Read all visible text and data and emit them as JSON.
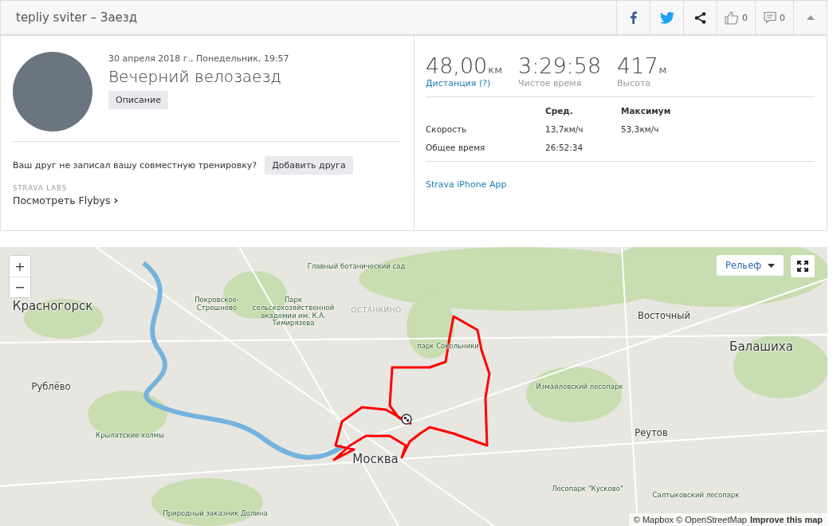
{
  "header": {
    "title": "tepliy sviter – Заезд",
    "kudos_count": "0",
    "comments_count": "0"
  },
  "activity": {
    "date": "30 апреля 2018 г., Понедельник, 19:57",
    "name": "Вечерний велозаезд",
    "description_button": "Описание",
    "friend_prompt": "Ваш друг не записал вашу совместную тренировку?",
    "add_friend_button": "Добавить друга",
    "labs_label": "STRAVA LABS",
    "flybys_link": "Посмотреть Flybys",
    "flybys_arrow": "›"
  },
  "stats": {
    "primary": [
      {
        "value": "48,00",
        "unit": "км",
        "label": "Дистанция (?)",
        "kind": "link"
      },
      {
        "value": "3:29:58",
        "label": "Чистое время",
        "kind": "plain"
      },
      {
        "value": "417",
        "unit": "м",
        "label": "Высота",
        "kind": "plain"
      }
    ],
    "columns": [
      "Сред.",
      "Максимум"
    ],
    "rows": [
      {
        "label": "Скорость",
        "avg": "13,7км/ч",
        "max": "53,3км/ч"
      },
      {
        "label": "Общее время",
        "avg": "26:52:34"
      }
    ],
    "device": "Strava iPhone App"
  },
  "map": {
    "zoom_in": "+",
    "zoom_out": "−",
    "layer_button": "Рельеф",
    "attribution": "© Mapbox © OpenStreetMap",
    "improve_link": "Improve this map",
    "labels": [
      {
        "text": "Главный ботанический сад",
        "kind": "small"
      },
      {
        "text": "Красногорск",
        "kind": "city"
      },
      {
        "text": "Покровское-Стрешнево",
        "kind": "small"
      },
      {
        "text": "Парк сельскохозяйственной академии им. К.А. Тимирязева",
        "kind": "small"
      },
      {
        "text": "ОСТАНКИНО",
        "kind": "district"
      },
      {
        "text": "Восточный",
        "kind": "town"
      },
      {
        "text": "парк Сокольники",
        "kind": "small"
      },
      {
        "text": "Балашиха",
        "kind": "city"
      },
      {
        "text": "Рублёво",
        "kind": "town"
      },
      {
        "text": "Измайловский лесопарк",
        "kind": "small"
      },
      {
        "text": "Крылатские холмы",
        "kind": "small"
      },
      {
        "text": "Реутов",
        "kind": "town"
      },
      {
        "text": "Москва",
        "kind": "city"
      },
      {
        "text": "Лесопарк \"Кусково\"",
        "kind": "small"
      },
      {
        "text": "Салтыковский лесопарк",
        "kind": "small"
      },
      {
        "text": "Природный заказник Долина",
        "kind": "small"
      }
    ]
  }
}
